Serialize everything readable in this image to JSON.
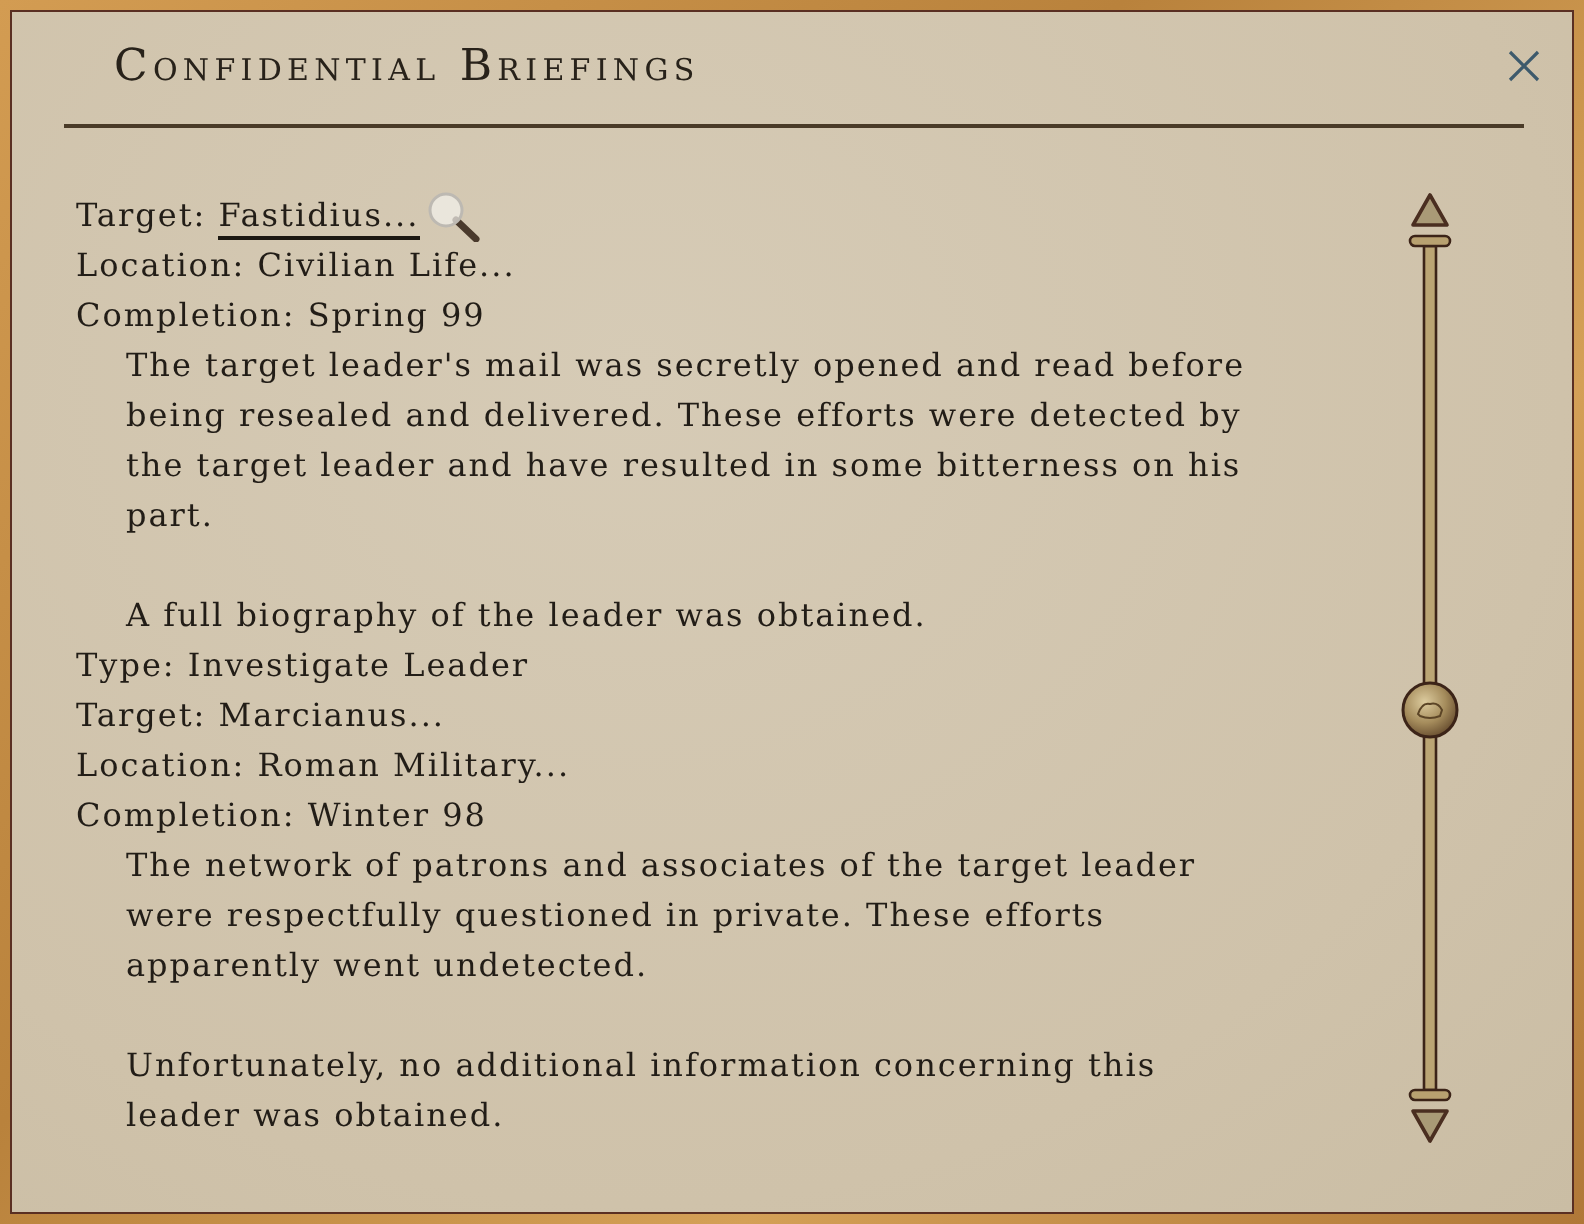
{
  "window": {
    "title": "Confidential Briefings"
  },
  "briefings": [
    {
      "fields": [
        {
          "label": "Target:",
          "value": "Fastidius...",
          "hovered": true
        },
        {
          "label": "Location:",
          "value": "Civilian Life...",
          "hovered": false
        },
        {
          "label": "Completion:",
          "value": "Spring 99",
          "hovered": false
        }
      ],
      "paragraphs": [
        "The target leader's mail was secretly opened and read before being resealed and delivered. These efforts were detected by the target leader and have resulted in some bitterness on his part.",
        "A full biography of the leader was obtained."
      ]
    },
    {
      "fields": [
        {
          "label": "Type:",
          "value": "Investigate Leader",
          "hovered": false
        },
        {
          "label": "Target:",
          "value": "Marcianus...",
          "hovered": false
        },
        {
          "label": "Location:",
          "value": "Roman Military...",
          "hovered": false
        },
        {
          "label": "Completion:",
          "value": "Winter 98",
          "hovered": false
        }
      ],
      "paragraphs": [
        "The network of patrons and associates of the target leader were respectfully questioned in private. These efforts apparently went undetected.",
        "Unfortunately, no additional information concerning this leader was obtained."
      ]
    }
  ]
}
